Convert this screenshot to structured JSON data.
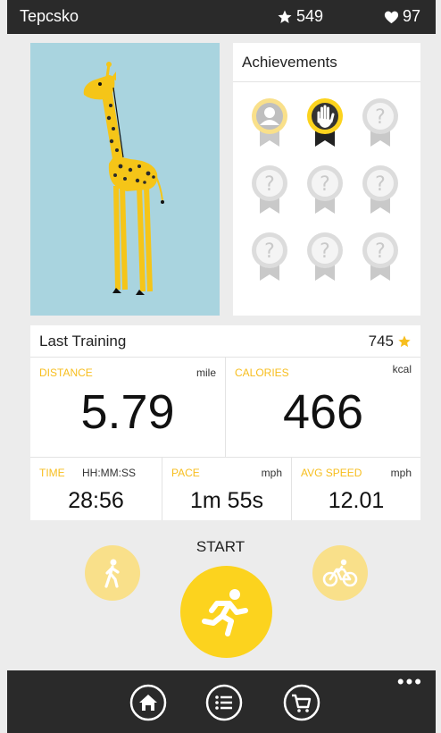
{
  "status_bar": {
    "title": "Tepcsko",
    "stars": "549",
    "hearts": "97"
  },
  "achievements": {
    "title": "Achievements",
    "badges": [
      {
        "icon": "avatar-badge-icon",
        "unlocked": true
      },
      {
        "icon": "hand-badge-icon",
        "unlocked": true
      },
      {
        "icon": "locked-badge-icon",
        "unlocked": false
      },
      {
        "icon": "locked-badge-icon",
        "unlocked": false
      },
      {
        "icon": "locked-badge-icon",
        "unlocked": false
      },
      {
        "icon": "locked-badge-icon",
        "unlocked": false
      },
      {
        "icon": "locked-badge-icon",
        "unlocked": false
      },
      {
        "icon": "locked-badge-icon",
        "unlocked": false
      },
      {
        "icon": "locked-badge-icon",
        "unlocked": false
      }
    ]
  },
  "last_training": {
    "title": "Last Training",
    "points": "745",
    "distance": {
      "label": "DISTANCE",
      "unit": "mile",
      "value": "5.79"
    },
    "calories": {
      "label": "CALORIES",
      "unit": "kcal",
      "value": "466"
    },
    "time": {
      "label": "TIME",
      "unit": "HH:MM:SS",
      "value": "28:56"
    },
    "pace": {
      "label": "PACE",
      "unit": "mph",
      "value": "1m 55s"
    },
    "avg_speed": {
      "label": "AVG SPEED",
      "unit": "mph",
      "value": "12.01"
    }
  },
  "actions": {
    "start_label": "START"
  },
  "app_bar": {
    "more": "•••",
    "icons": [
      "home-icon",
      "list-icon",
      "cart-icon"
    ]
  },
  "colors": {
    "accent": "#fcd31e",
    "accent_light": "#f9e08a",
    "label": "#f7be1e",
    "bar": "#2a2a2a",
    "giraffe_bg": "#a9d4df"
  }
}
